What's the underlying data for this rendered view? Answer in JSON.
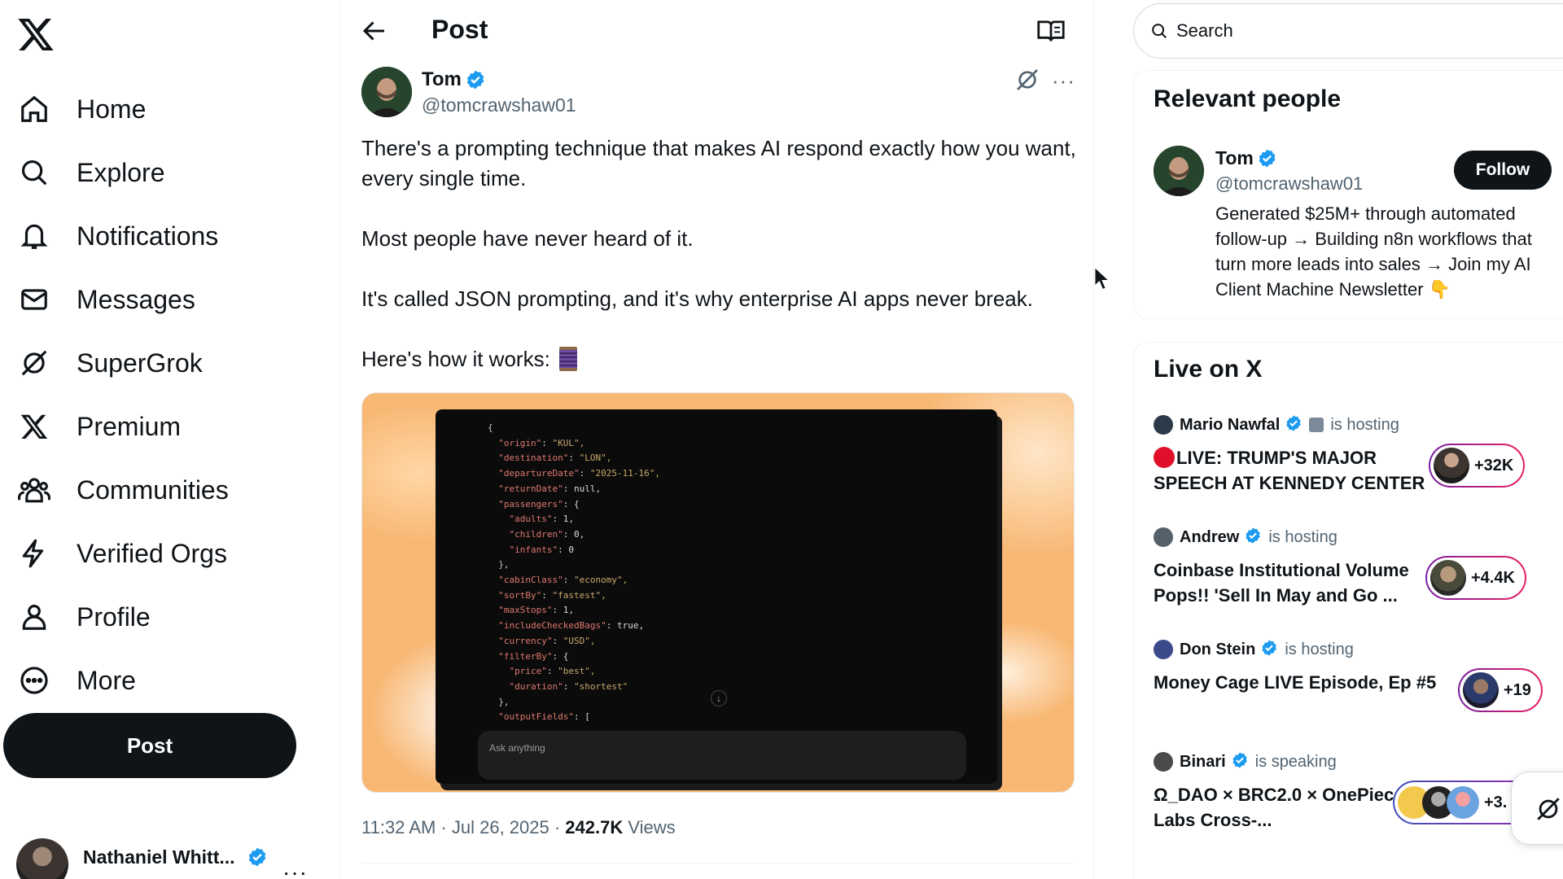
{
  "sidebar": {
    "items": [
      {
        "label": "Home",
        "icon": "home-icon"
      },
      {
        "label": "Explore",
        "icon": "search-icon"
      },
      {
        "label": "Notifications",
        "icon": "bell-icon"
      },
      {
        "label": "Messages",
        "icon": "mail-icon"
      },
      {
        "label": "SuperGrok",
        "icon": "grok-icon"
      },
      {
        "label": "Premium",
        "icon": "x-logo-icon"
      },
      {
        "label": "Communities",
        "icon": "people-icon"
      },
      {
        "label": "Verified Orgs",
        "icon": "lightning-icon"
      },
      {
        "label": "Profile",
        "icon": "person-icon"
      },
      {
        "label": "More",
        "icon": "more-circle-icon"
      }
    ],
    "post_button": "Post",
    "account": {
      "name": "Nathaniel Whitt...",
      "more": "···"
    }
  },
  "header": {
    "title": "Post"
  },
  "tweet": {
    "author": {
      "name": "Tom",
      "handle": "@tomcrawshaw01",
      "verified": true
    },
    "more": "···",
    "paragraphs": [
      "There's a prompting technique that makes AI respond exactly how you want, every single time.",
      "Most people have never heard of it.",
      "It's called JSON prompting, and it's why enterprise AI apps never break.",
      "Here's how it works:"
    ],
    "media": {
      "code_lines": [
        {
          "t": "{",
          "i": 0
        },
        {
          "k": "\"origin\"",
          "v": "\"KUL\",",
          "i": 1
        },
        {
          "k": "\"destination\"",
          "v": "\"LON\",",
          "i": 1
        },
        {
          "k": "\"departureDate\"",
          "v": "\"2025-11-16\",",
          "i": 1
        },
        {
          "k": "\"returnDate\"",
          "v": "null,",
          "i": 1
        },
        {
          "k": "\"passengers\"",
          "v": "{",
          "i": 1
        },
        {
          "k": "\"adults\"",
          "v": "1,",
          "i": 2
        },
        {
          "k": "\"children\"",
          "v": "0,",
          "i": 2
        },
        {
          "k": "\"infants\"",
          "v": "0",
          "i": 2
        },
        {
          "t": "},",
          "i": 1
        },
        {
          "k": "\"cabinClass\"",
          "v": "\"economy\",",
          "i": 1
        },
        {
          "k": "\"sortBy\"",
          "v": "\"fastest\",",
          "i": 1
        },
        {
          "k": "\"maxStops\"",
          "v": "1,",
          "i": 1
        },
        {
          "k": "\"includeCheckedBags\"",
          "v": "true,",
          "i": 1
        },
        {
          "k": "\"currency\"",
          "v": "\"USD\",",
          "i": 1
        },
        {
          "k": "\"filterBy\"",
          "v": "{",
          "i": 1
        },
        {
          "k": "\"price\"",
          "v": "\"best\",",
          "i": 2
        },
        {
          "k": "\"duration\"",
          "v": "\"shortest\"",
          "i": 2
        },
        {
          "t": "},",
          "i": 1
        },
        {
          "k": "\"outputFields\"",
          "v": "[",
          "i": 1
        }
      ],
      "ask_placeholder": "Ask anything",
      "down_arrow": "↓"
    },
    "time": "11:32 AM · Jul 26, 2025 · ",
    "views_count": "242.7K",
    "views_label": " Views"
  },
  "search": {
    "placeholder": "Search"
  },
  "relevant": {
    "title": "Relevant people",
    "person": {
      "name": "Tom",
      "handle": "@tomcrawshaw01",
      "follow": "Follow",
      "bio": "Generated $25M+ through automated follow-up → Building n8n workflows that turn more leads into sales → Join my AI Client Machine Newsletter 👇"
    }
  },
  "live": {
    "title": "Live on X",
    "items": [
      {
        "host": "Mario Nawfal",
        "status": "is hosting",
        "title": "LIVE: TRUMP'S MAJOR SPEECH AT KENNEDY CENTER",
        "count": "+32K",
        "rec": true
      },
      {
        "host": "Andrew",
        "status": "is hosting",
        "title": "Coinbase Institutional Volume Pops!! 'Sell In May and Go ...",
        "count": "+4.4K",
        "rec": false
      },
      {
        "host": "Don Stein",
        "status": "is hosting",
        "title": "Money Cage LIVE Episode, Ep #5",
        "count": "+19",
        "rec": false
      },
      {
        "host": "Binari",
        "status": "is speaking",
        "title": "Ω_DAO × BRC2.0 × OnePiece Labs Cross-...",
        "count": "+3.",
        "rec": false
      }
    ]
  },
  "colors": {
    "accent": "#1d9bf0",
    "text": "#0f1419",
    "muted": "#536471",
    "live_ring_start": "#7a1fa2",
    "live_ring_end": "#e91e63"
  }
}
